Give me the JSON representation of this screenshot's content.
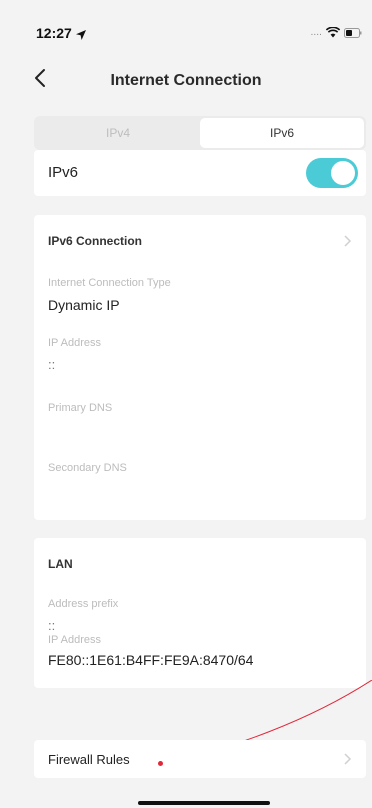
{
  "status_bar": {
    "time": "12:27",
    "signal": "....",
    "location_icon": "location-arrow-icon",
    "wifi_icon": "wifi-icon",
    "battery_icon": "battery-icon"
  },
  "header": {
    "title": "Internet Connection",
    "back_icon": "chevron-left-icon"
  },
  "tabs": [
    {
      "label": "IPv4",
      "active": false
    },
    {
      "label": "IPv6",
      "active": true
    }
  ],
  "ipv6_toggle": {
    "label": "IPv6",
    "enabled": true
  },
  "ipv6_connection": {
    "title": "IPv6 Connection",
    "fields": [
      {
        "label": "Internet Connection Type",
        "value": "Dynamic IP"
      },
      {
        "label": "IP Address",
        "value": "::"
      },
      {
        "label": "Primary DNS",
        "value": ""
      },
      {
        "label": "Secondary DNS",
        "value": ""
      }
    ]
  },
  "lan": {
    "title": "LAN",
    "fields": [
      {
        "label": "Address prefix",
        "value": "::"
      },
      {
        "label": "IP Address",
        "value": "FE80::1E61:B4FF:FE9A:8470/64"
      }
    ]
  },
  "firewall": {
    "label": "Firewall Rules"
  },
  "colors": {
    "toggle_on": "#4acbd6",
    "annotation": "#e0283a",
    "background": "#f3f3f4"
  }
}
